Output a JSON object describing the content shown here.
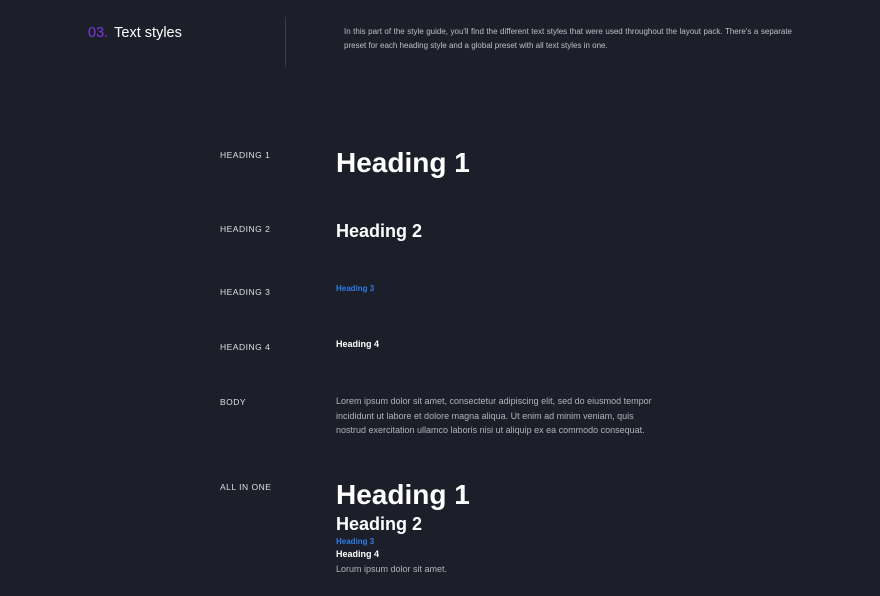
{
  "header": {
    "number": "03.",
    "title": "Text styles",
    "description": "In this part of the style guide, you'll find the different text styles that were used throughout the layout pack. There's a separate preset for each heading style and a global preset with all text styles in one."
  },
  "rows": {
    "h1": {
      "label": "HEADING 1",
      "sample": "Heading 1"
    },
    "h2": {
      "label": "HEADING 2",
      "sample": "Heading 2"
    },
    "h3": {
      "label": "HEADING 3",
      "sample": "Heading 3"
    },
    "h4": {
      "label": "HEADING 4",
      "sample": "Heading 4"
    },
    "body": {
      "label": "BODY",
      "sample": "Lorem ipsum dolor sit amet, consectetur adipiscing elit, sed do eiusmod tempor incididunt ut labore et dolore magna aliqua. Ut enim ad minim veniam, quis nostrud exercitation ullamco laboris nisi ut aliquip ex ea commodo consequat."
    },
    "allinone": {
      "label": "ALL IN ONE",
      "h1": "Heading 1",
      "h2": "Heading 2",
      "h3": "Heading 3",
      "h4": "Heading 4",
      "body": "Lorum ipsum dolor sit amet."
    }
  }
}
